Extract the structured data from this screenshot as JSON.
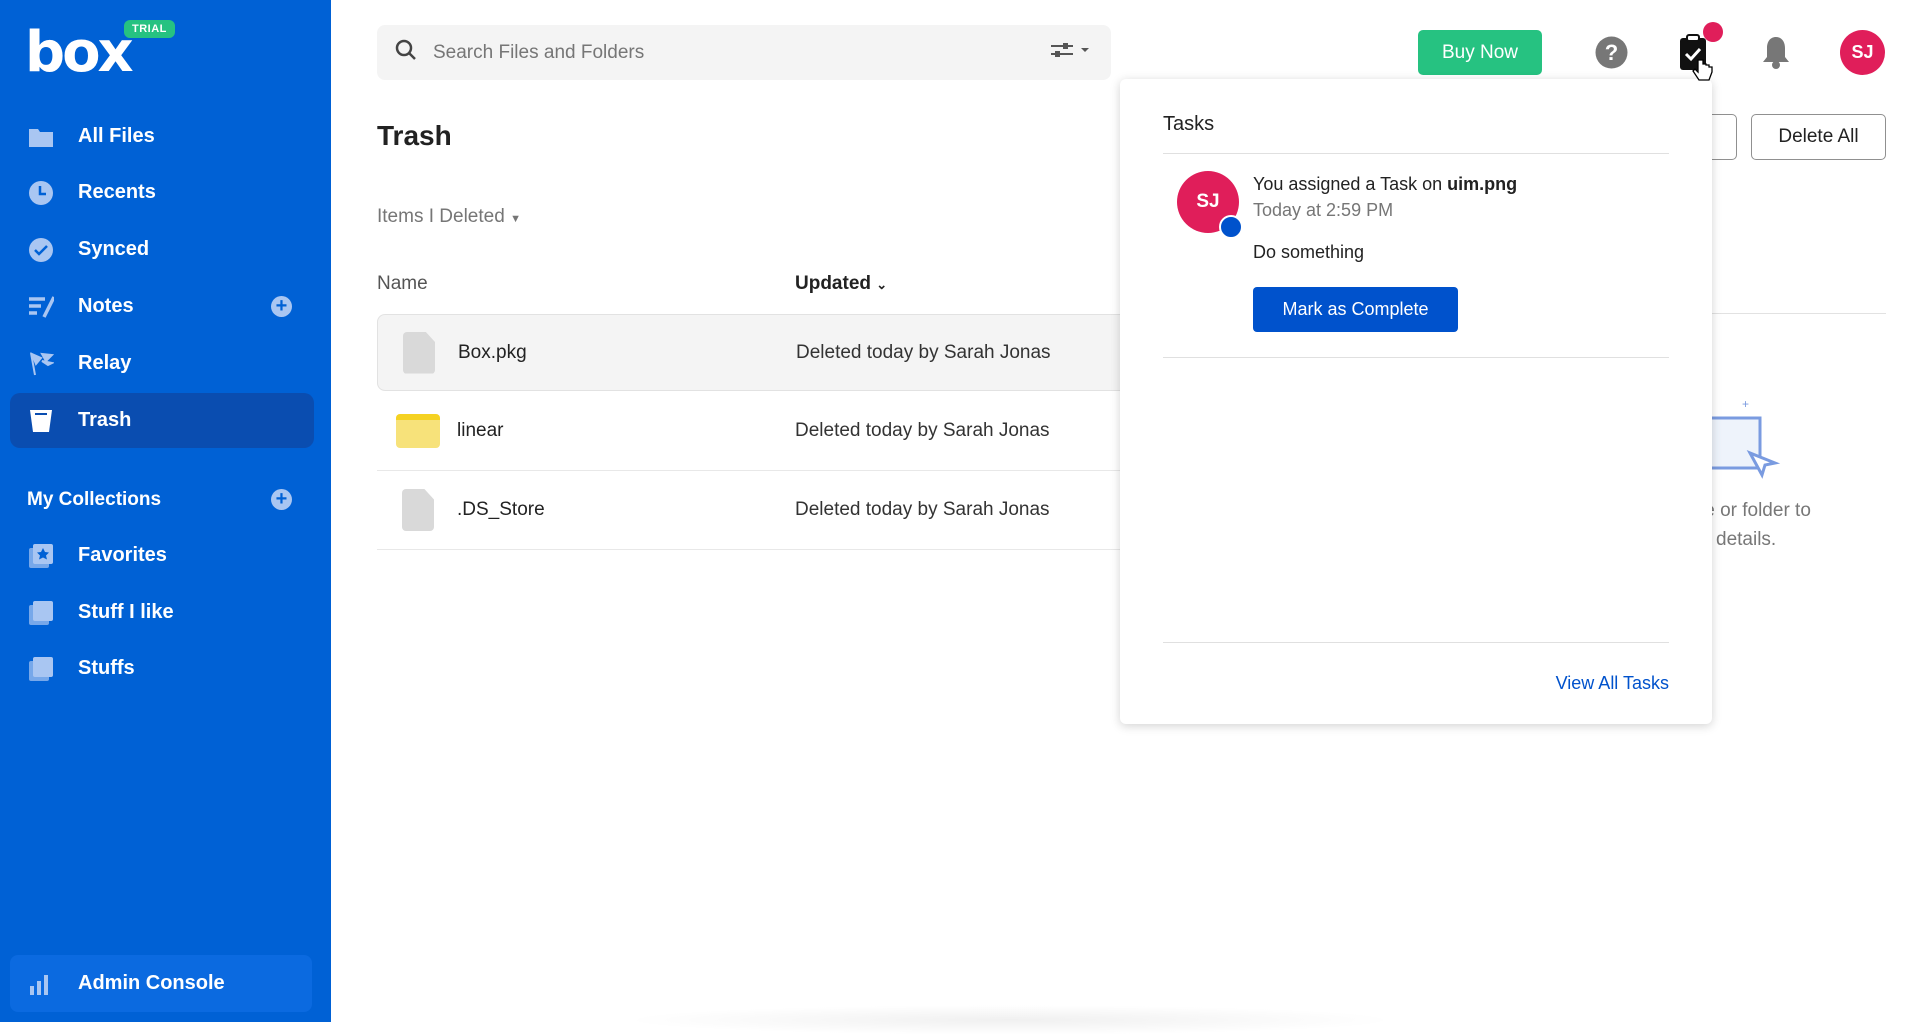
{
  "brand": {
    "logo": "box",
    "badge": "TRIAL"
  },
  "sidebar": {
    "items": [
      {
        "label": "All Files",
        "icon": "folder-icon"
      },
      {
        "label": "Recents",
        "icon": "clock-icon"
      },
      {
        "label": "Synced",
        "icon": "check-circle-icon"
      },
      {
        "label": "Notes",
        "icon": "notes-icon"
      },
      {
        "label": "Relay",
        "icon": "relay-icon"
      },
      {
        "label": "Trash",
        "icon": "trash-icon",
        "active": true
      }
    ],
    "collections_label": "My Collections",
    "collections": [
      {
        "label": "Favorites"
      },
      {
        "label": "Stuff I like"
      },
      {
        "label": "Stuffs"
      }
    ],
    "admin_label": "Admin Console"
  },
  "header": {
    "search_placeholder": "Search Files and Folders",
    "buy_now": "Buy Now",
    "avatar": "SJ"
  },
  "main": {
    "title": "Trash",
    "filter": "Items I Deleted",
    "col_name": "Name",
    "col_updated": "Updated",
    "rows": [
      {
        "name": "Box.pkg",
        "type": "file",
        "updated": "Deleted today by Sarah Jonas"
      },
      {
        "name": "linear",
        "type": "folder",
        "updated": "Deleted today by Sarah Jonas"
      },
      {
        "name": ".DS_Store",
        "type": "file",
        "updated": "Deleted today by Sarah Jonas"
      }
    ],
    "delete_all": "Delete All",
    "empty_line1": "le or folder to",
    "empty_line2": "details."
  },
  "tasks_panel": {
    "title": "Tasks",
    "avatar": "SJ",
    "message_prefix": "You assigned a Task on ",
    "file": "uim.png",
    "time": "Today at 2:59 PM",
    "task": "Do something",
    "mark_complete": "Mark as Complete",
    "view_all": "View All Tasks"
  },
  "colors": {
    "sidebar": "#0061d5",
    "accent": "#0052cc",
    "buy": "#26c281",
    "avatar": "#e01e5a"
  }
}
